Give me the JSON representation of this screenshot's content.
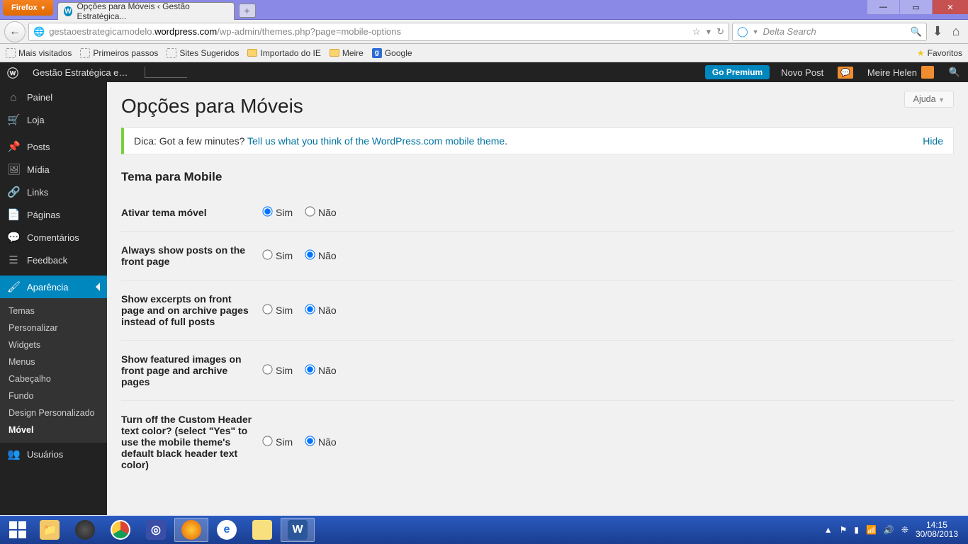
{
  "browser": {
    "name": "Firefox",
    "tab_title": "Opções para Móveis ‹ Gestão Estratégica...",
    "url_prefix": "gestaoestrategicamodelo.",
    "url_domain": "wordpress.com",
    "url_path": "/wp-admin/themes.php?page=mobile-options",
    "search_placeholder": "Delta Search"
  },
  "bookmarks": {
    "most_visited": "Mais visitados",
    "first_steps": "Primeiros passos",
    "suggested": "Sites Sugeridos",
    "imported": "Importado do IE",
    "meire": "Meire",
    "google": "Google",
    "favorites": "Favoritos"
  },
  "adminbar": {
    "site_name": "Gestão Estratégica e…",
    "go_premium": "Go Premium",
    "new_post": "Novo Post",
    "user": "Meire Helen"
  },
  "sidebar": {
    "painel": "Painel",
    "loja": "Loja",
    "posts": "Posts",
    "midia": "Mídia",
    "links": "Links",
    "paginas": "Páginas",
    "comentarios": "Comentários",
    "feedback": "Feedback",
    "aparencia": "Aparência",
    "usuarios": "Usuários",
    "sub": {
      "temas": "Temas",
      "personalizar": "Personalizar",
      "widgets": "Widgets",
      "menus": "Menus",
      "cabecalho": "Cabeçalho",
      "fundo": "Fundo",
      "design": "Design Personalizado",
      "movel": "Móvel"
    }
  },
  "content": {
    "help": "Ajuda",
    "page_title": "Opções para Móveis",
    "notice_prefix": "Dica: Got a few minutes? ",
    "notice_link": "Tell us what you think of the WordPress.com mobile theme",
    "notice_hide": "Hide",
    "section_title": "Tema para Mobile",
    "yes": "Sim",
    "no": "Não",
    "rows": {
      "0": {
        "label": "Ativar tema móvel",
        "selected": "sim"
      },
      "1": {
        "label": "Always show posts on the front page",
        "selected": "nao"
      },
      "2": {
        "label": "Show excerpts on front page and on archive pages instead of full posts",
        "selected": "nao"
      },
      "3": {
        "label": "Show featured images on front page and archive pages",
        "selected": "nao"
      },
      "4": {
        "label": "Turn off the Custom Header text color? (select \"Yes\" to use the mobile theme's default black header text color)",
        "selected": "nao"
      }
    }
  },
  "taskbar": {
    "time": "14:15",
    "date": "30/08/2013"
  }
}
